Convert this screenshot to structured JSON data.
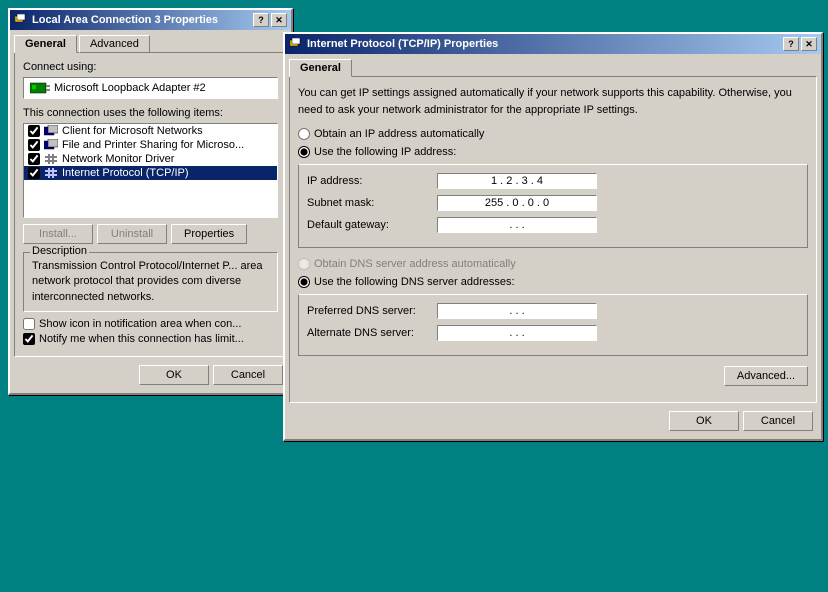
{
  "win1": {
    "title": "Local Area Connection 3 Properties",
    "tabs": [
      {
        "label": "General",
        "active": true
      },
      {
        "label": "Advanced",
        "active": false
      }
    ],
    "connect_using_label": "Connect using:",
    "adapter_name": "Microsoft Loopback Adapter #2",
    "connection_items_label": "This connection uses the following items:",
    "items": [
      {
        "label": "Client for Microsoft Networks",
        "checked": true,
        "icon": "net"
      },
      {
        "label": "File and Printer Sharing for Microso...",
        "checked": true,
        "icon": "net"
      },
      {
        "label": "Network Monitor Driver",
        "checked": true,
        "icon": "net"
      },
      {
        "label": "Internet Protocol (TCP/IP)",
        "checked": true,
        "icon": "net",
        "selected": true
      }
    ],
    "install_btn": "Install...",
    "uninstall_btn": "Uninstall",
    "properties_btn": "Properties",
    "description_label": "Description",
    "description_text": "Transmission Control Protocol/Internet P... area network protocol that provides com diverse interconnected networks.",
    "show_icon_label": "Show icon in notification area when con...",
    "notify_label": "Notify me when this connection has limit...",
    "ok_btn": "OK",
    "cancel_btn": "Cancel"
  },
  "win2": {
    "title": "Internet Protocol (TCP/IP) Properties",
    "tabs": [
      {
        "label": "General",
        "active": true
      }
    ],
    "description": "You can get IP settings assigned automatically if your network supports this capability. Otherwise, you need to ask your network administrator for the appropriate IP settings.",
    "obtain_auto_radio": "Obtain an IP address automatically",
    "use_following_radio": "Use the following IP address:",
    "ip_address_label": "IP address:",
    "ip_address_value": "1 . 2 . 3 . 4",
    "subnet_mask_label": "Subnet mask:",
    "subnet_mask_value": "255 . 0 . 0 . 0",
    "default_gateway_label": "Default gateway:",
    "default_gateway_value": ". . .",
    "obtain_dns_radio": "Obtain DNS server address automatically",
    "use_dns_radio": "Use the following DNS server addresses:",
    "preferred_dns_label": "Preferred DNS server:",
    "preferred_dns_value": ". . .",
    "alternate_dns_label": "Alternate DNS server:",
    "alternate_dns_value": ". . .",
    "advanced_btn": "Advanced...",
    "ok_btn": "OK",
    "cancel_btn": "Cancel",
    "help_btn": "?",
    "close_btn": "✕"
  }
}
